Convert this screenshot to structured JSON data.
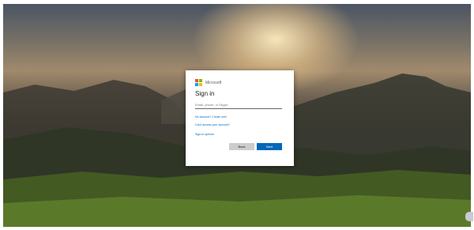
{
  "brand": {
    "name": "Microsoft",
    "logo_colors": [
      "#f25022",
      "#7fba00",
      "#00a4ef",
      "#ffb900"
    ]
  },
  "signin": {
    "title": "Sign in",
    "email_placeholder": "Email, phone, or Skype",
    "links": [
      "No account? Create one!",
      "Can't access your account?",
      "Sign-in options"
    ],
    "back_label": "Back",
    "next_label": "Next"
  },
  "colors": {
    "accent": "#0067b8"
  }
}
